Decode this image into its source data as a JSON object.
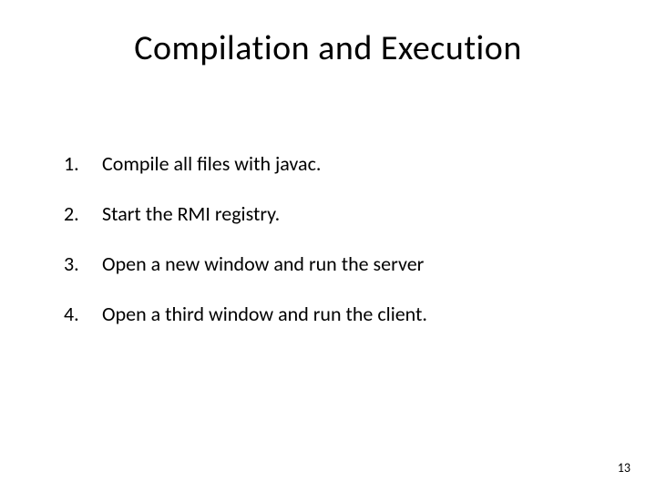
{
  "title": "Compilation and Execution",
  "items": [
    {
      "number": "1.",
      "text": "Compile all files with javac."
    },
    {
      "number": "2.",
      "text": "Start the RMI registry."
    },
    {
      "number": "3.",
      "text": "Open a new window and run the server"
    },
    {
      "number": "4.",
      "text": "Open a third window and run the client."
    }
  ],
  "page_number": "13"
}
